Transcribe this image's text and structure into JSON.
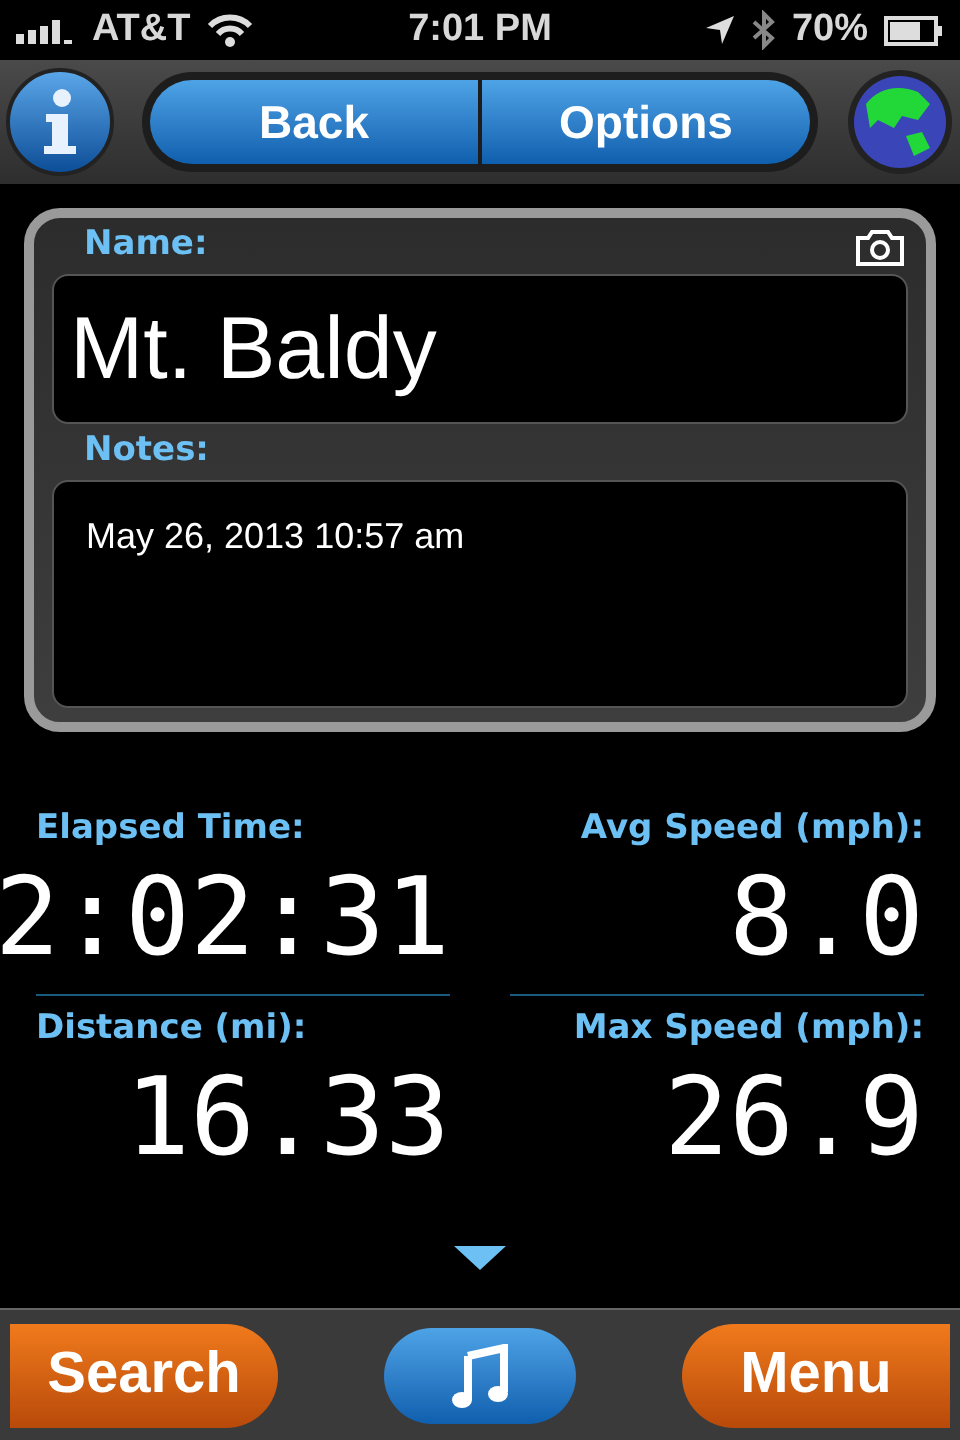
{
  "status_bar": {
    "carrier": "AT&T",
    "time": "7:01 PM",
    "battery": "70%"
  },
  "toolbar": {
    "buttons": [
      "Back",
      "Options"
    ]
  },
  "details": {
    "name_label": "Name:",
    "name": "Mt. Baldy",
    "notes_label": "Notes:",
    "notes": "May 26, 2013 10:57 am"
  },
  "stats": [
    {
      "label": "Elapsed Time:",
      "value": "2:02:31"
    },
    {
      "label": "Avg Speed (mph):",
      "value": "8.0"
    },
    {
      "label": "Distance (mi):",
      "value": "16.33"
    },
    {
      "label": "Max Speed (mph):",
      "value": "26.9"
    }
  ],
  "bottom_bar": {
    "left": "Search",
    "right": "Menu"
  }
}
